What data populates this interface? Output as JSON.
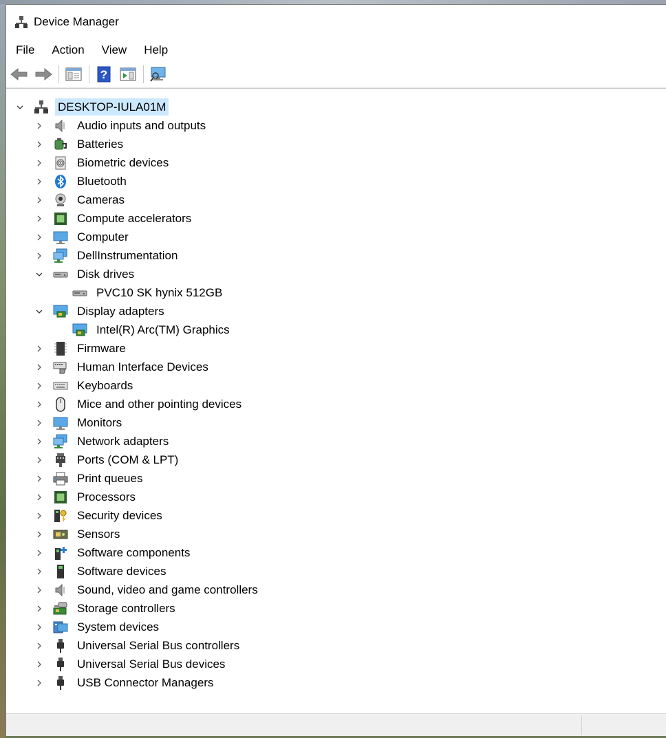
{
  "window": {
    "title": "Device Manager"
  },
  "menu": [
    "File",
    "Action",
    "View",
    "Help"
  ],
  "toolbar": [
    {
      "icon": "back-arrow-icon"
    },
    {
      "icon": "forward-arrow-icon"
    },
    {
      "icon": "show-hide-console-tree-icon"
    },
    {
      "icon": "help-icon"
    },
    {
      "icon": "show-action-pane-icon"
    },
    {
      "icon": "scan-hardware-changes-icon"
    }
  ],
  "tree": {
    "root": "DESKTOP-IULA01M",
    "items": [
      {
        "label": "Audio inputs and outputs",
        "icon": "speaker-icon",
        "expanded": false
      },
      {
        "label": "Batteries",
        "icon": "battery-icon",
        "expanded": false
      },
      {
        "label": "Biometric devices",
        "icon": "fingerprint-icon",
        "expanded": false
      },
      {
        "label": "Bluetooth",
        "icon": "bluetooth-icon",
        "expanded": false
      },
      {
        "label": "Cameras",
        "icon": "camera-icon",
        "expanded": false
      },
      {
        "label": "Compute accelerators",
        "icon": "chip-icon",
        "expanded": false
      },
      {
        "label": "Computer",
        "icon": "monitor-icon",
        "expanded": false
      },
      {
        "label": "DellInstrumentation",
        "icon": "network-monitor-icon",
        "expanded": false
      },
      {
        "label": "Disk drives",
        "icon": "disk-drive-icon",
        "expanded": true,
        "children": [
          {
            "label": "PVC10 SK hynix 512GB",
            "icon": "disk-drive-icon"
          }
        ]
      },
      {
        "label": "Display adapters",
        "icon": "display-adapter-icon",
        "expanded": true,
        "children": [
          {
            "label": "Intel(R) Arc(TM) Graphics",
            "icon": "display-adapter-icon"
          }
        ]
      },
      {
        "label": "Firmware",
        "icon": "firmware-chip-icon",
        "expanded": false
      },
      {
        "label": "Human Interface Devices",
        "icon": "hid-icon",
        "expanded": false
      },
      {
        "label": "Keyboards",
        "icon": "keyboard-icon",
        "expanded": false
      },
      {
        "label": "Mice and other pointing devices",
        "icon": "mouse-icon",
        "expanded": false
      },
      {
        "label": "Monitors",
        "icon": "monitor-icon",
        "expanded": false
      },
      {
        "label": "Network adapters",
        "icon": "network-monitor-icon",
        "expanded": false
      },
      {
        "label": "Ports (COM & LPT)",
        "icon": "port-icon",
        "expanded": false
      },
      {
        "label": "Print queues",
        "icon": "printer-icon",
        "expanded": false
      },
      {
        "label": "Processors",
        "icon": "chip-icon",
        "expanded": false
      },
      {
        "label": "Security devices",
        "icon": "security-key-icon",
        "expanded": false
      },
      {
        "label": "Sensors",
        "icon": "sensor-icon",
        "expanded": false
      },
      {
        "label": "Software components",
        "icon": "software-component-icon",
        "expanded": false
      },
      {
        "label": "Software devices",
        "icon": "software-device-icon",
        "expanded": false
      },
      {
        "label": "Sound, video and game controllers",
        "icon": "speaker-icon",
        "expanded": false
      },
      {
        "label": "Storage controllers",
        "icon": "storage-controller-icon",
        "expanded": false
      },
      {
        "label": "System devices",
        "icon": "system-devices-icon",
        "expanded": false
      },
      {
        "label": "Universal Serial Bus controllers",
        "icon": "usb-icon",
        "expanded": false
      },
      {
        "label": "Universal Serial Bus devices",
        "icon": "usb-icon",
        "expanded": false
      },
      {
        "label": "USB Connector Managers",
        "icon": "usb-icon",
        "expanded": false
      }
    ]
  },
  "colors": {
    "selection": "#cce8ff",
    "status_bar": "#f0f0f0"
  }
}
